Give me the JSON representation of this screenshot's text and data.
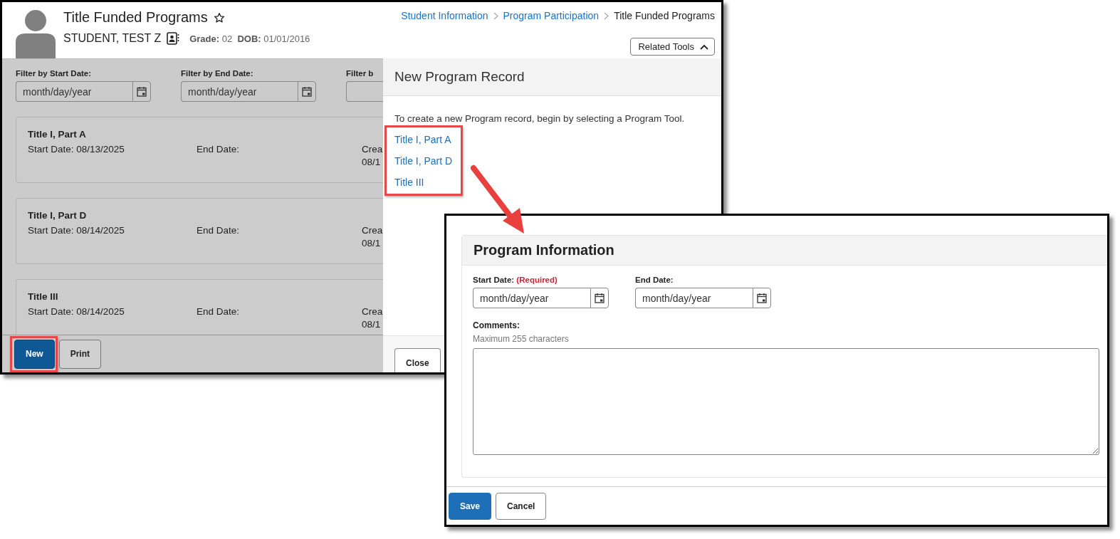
{
  "main_window": {
    "header": {
      "title": "Title Funded Programs",
      "student_name": "STUDENT, TEST Z",
      "grade_label": "Grade:",
      "grade": "02",
      "dob_label": "DOB:",
      "dob": "01/01/2016"
    },
    "breadcrumb": [
      {
        "label": "Student Information",
        "current": false
      },
      {
        "label": "Program Participation",
        "current": false
      },
      {
        "label": "Title Funded Programs",
        "current": true
      }
    ],
    "related_tools": {
      "label": "Related Tools",
      "expanded": true
    },
    "filters": [
      {
        "label": "Filter by Start Date:",
        "placeholder": "month/day/year"
      },
      {
        "label": "Filter by End Date:",
        "placeholder": "month/day/year"
      },
      {
        "label": "Filter b"
      }
    ],
    "records": [
      {
        "title": "Title I, Part A",
        "start": "Start Date: 08/13/2025",
        "end": "End Date:",
        "column_3": [
          "Crea",
          "08/1"
        ]
      },
      {
        "title": "Title I, Part D",
        "start": "Start Date: 08/14/2025",
        "end": "End Date:",
        "column_3": [
          "Crea",
          "08/1"
        ]
      },
      {
        "title": "Title III",
        "start": "Start Date: 08/14/2025",
        "end": "End Date:",
        "column_3": [
          "Crea",
          "08/1"
        ]
      }
    ],
    "buttons": [
      {
        "label": "New",
        "kind": "primary",
        "highlighted": true
      },
      {
        "label": "Print",
        "kind": "secondary",
        "highlighted": false
      }
    ],
    "new_record_panel": {
      "title": "New Program Record",
      "instruction": "To create a new Program record, begin by selecting a Program Tool.",
      "tools_highlighted": true,
      "program_tools": [
        "Title I, Part A",
        "Title I, Part D",
        "Title III"
      ],
      "close_button": "Close"
    }
  },
  "dialog": {
    "section_title": "Program Information",
    "fields": [
      {
        "label": "Start Date:",
        "required_note": "(Required)",
        "placeholder": "month/day/year"
      },
      {
        "label": "End Date:",
        "placeholder": "month/day/year"
      }
    ],
    "comments": {
      "label": "Comments:",
      "hint": "Maximum 255 characters"
    },
    "buttons": [
      {
        "label": "Save",
        "kind": "primary"
      },
      {
        "label": "Cancel",
        "kind": "secondary"
      }
    ]
  }
}
